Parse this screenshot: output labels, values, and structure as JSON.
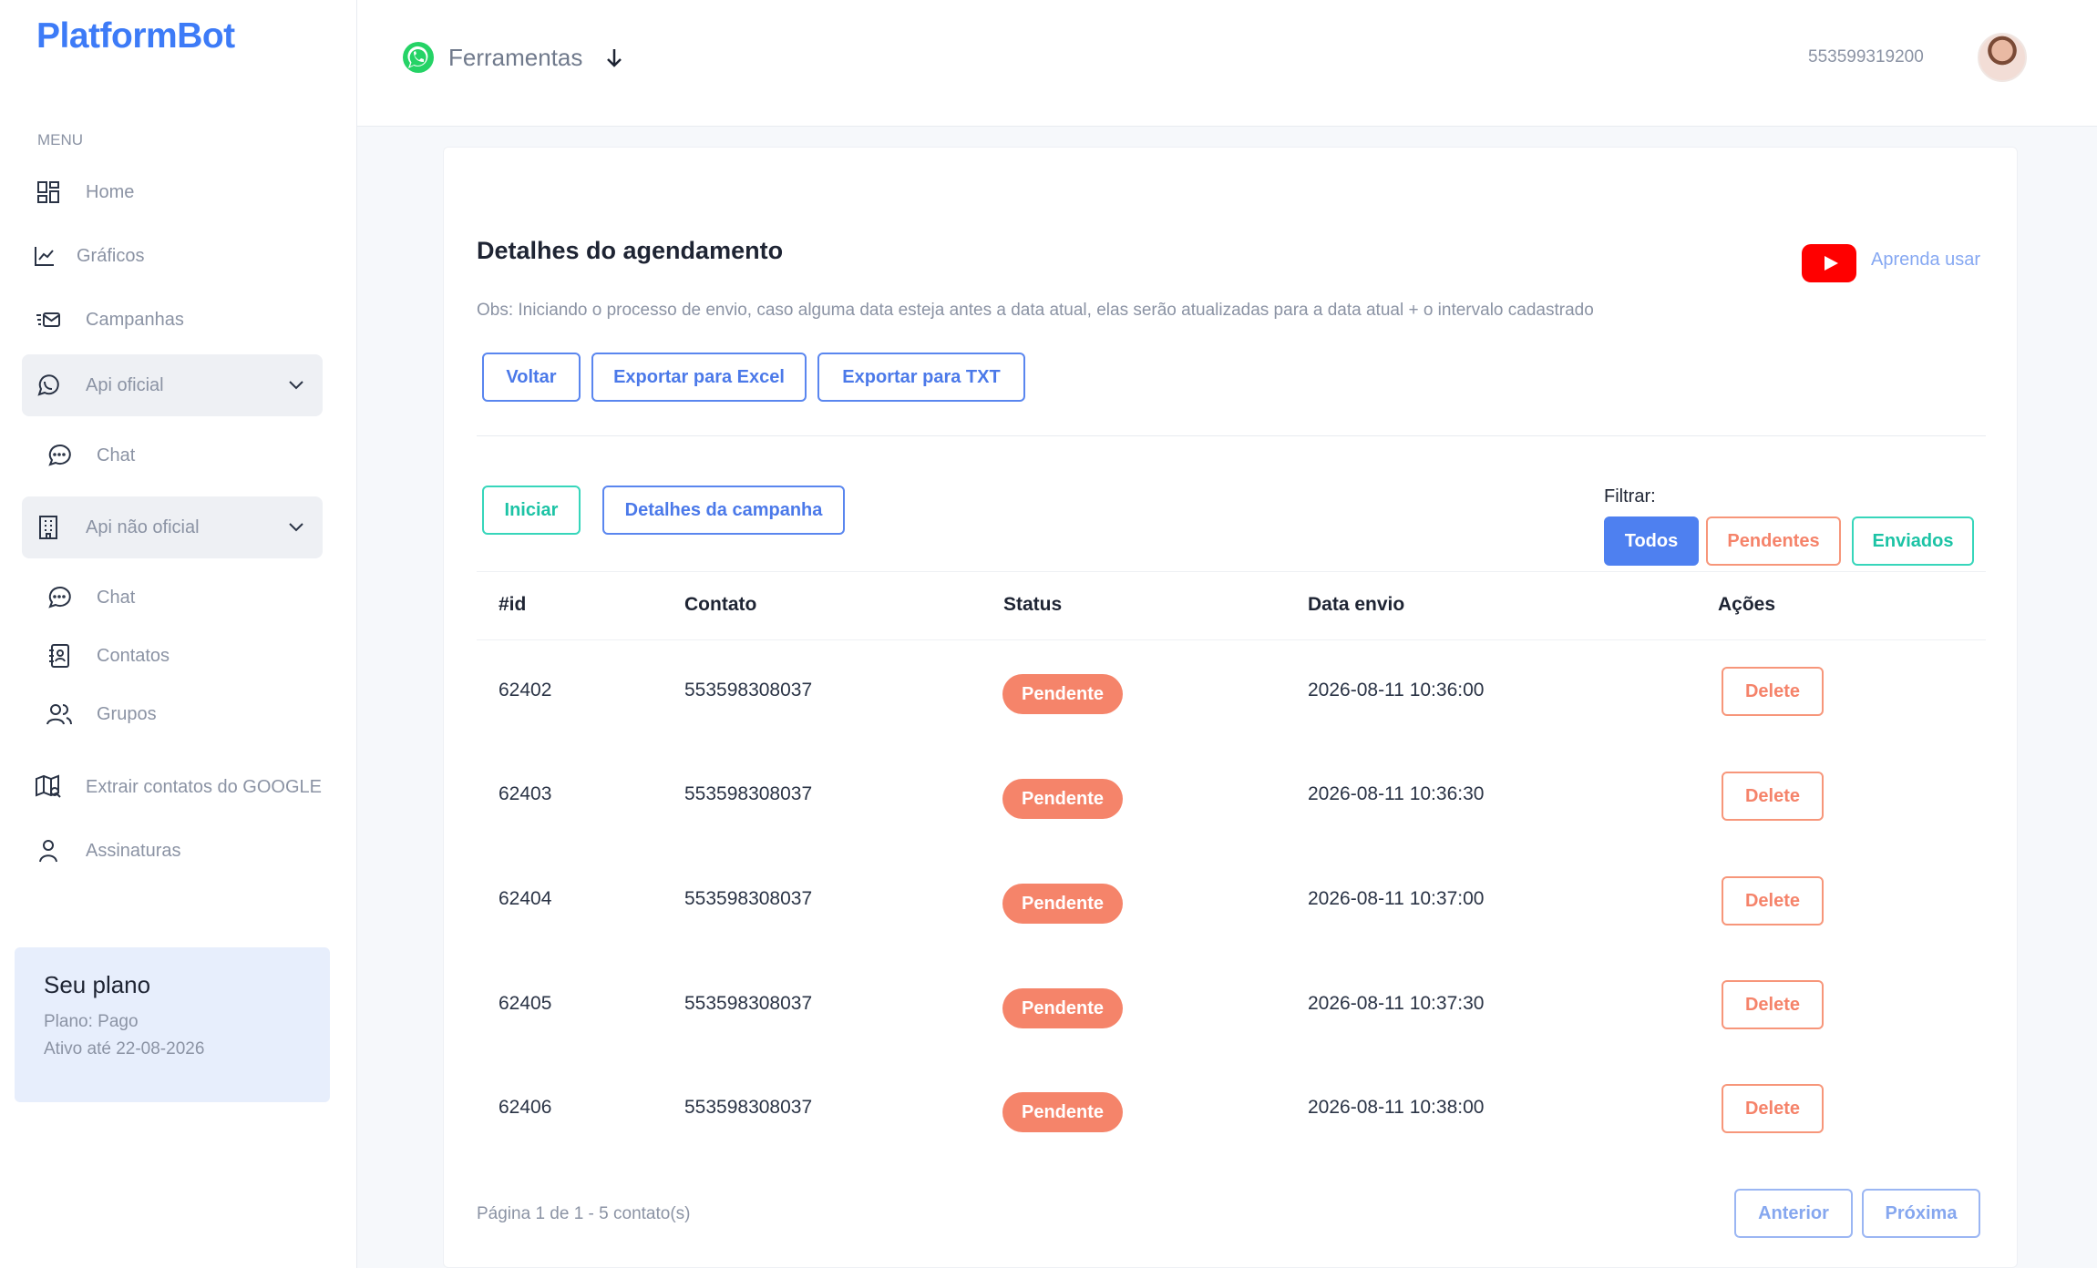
{
  "brand": {
    "logo": "PlatformBot"
  },
  "sidebar": {
    "menu_label": "MENU",
    "items": [
      {
        "label": "Home",
        "icon": "dashboard-icon"
      },
      {
        "label": "Gráficos",
        "icon": "chart-icon"
      },
      {
        "label": "Campanhas",
        "icon": "mail-icon"
      },
      {
        "label": "Api oficial",
        "icon": "whatsapp-icon",
        "expanded": true
      },
      {
        "label": "Chat",
        "icon": "chat-icon"
      },
      {
        "label": "Api não oficial",
        "icon": "building-icon",
        "expanded": true
      },
      {
        "label": "Chat",
        "icon": "chat-icon"
      },
      {
        "label": "Contatos",
        "icon": "contacts-icon"
      },
      {
        "label": "Grupos",
        "icon": "users-icon"
      },
      {
        "label": "Extrair contatos do GOOGLE",
        "icon": "map-icon"
      },
      {
        "label": "Assinaturas",
        "icon": "user-icon"
      }
    ],
    "plan": {
      "title": "Seu plano",
      "line1": "Plano: Pago",
      "line2": "Ativo até 22-08-2026"
    }
  },
  "header": {
    "tools_label": "Ferramentas",
    "phone": "553599319200"
  },
  "main": {
    "title": "Detalhes do agendamento",
    "learn_link": "Aprenda usar",
    "obs": "Obs: Iniciando o processo de envio, caso alguma data esteja antes a data atual, elas serão atualizadas para a data atual + o intervalo cadastrado",
    "buttons": {
      "back": "Voltar",
      "export_excel": "Exportar para Excel",
      "export_txt": "Exportar para TXT",
      "start": "Iniciar",
      "campaign_details": "Detalhes da campanha"
    },
    "filter": {
      "label": "Filtrar:",
      "all": "Todos",
      "pending": "Pendentes",
      "sent": "Enviados"
    },
    "table": {
      "headers": [
        "#id",
        "Contato",
        "Status",
        "Data envio",
        "Ações"
      ],
      "rows": [
        {
          "id": "62402",
          "contact": "553598308037",
          "status": "Pendente",
          "date": "2026-08-11 10:36:00",
          "action": "Delete"
        },
        {
          "id": "62403",
          "contact": "553598308037",
          "status": "Pendente",
          "date": "2026-08-11 10:36:30",
          "action": "Delete"
        },
        {
          "id": "62404",
          "contact": "553598308037",
          "status": "Pendente",
          "date": "2026-08-11 10:37:00",
          "action": "Delete"
        },
        {
          "id": "62405",
          "contact": "553598308037",
          "status": "Pendente",
          "date": "2026-08-11 10:37:30",
          "action": "Delete"
        },
        {
          "id": "62406",
          "contact": "553598308037",
          "status": "Pendente",
          "date": "2026-08-11 10:38:00",
          "action": "Delete"
        }
      ]
    },
    "pager": {
      "text": "Página 1 de 1 - 5 contato(s)",
      "prev": "Anterior",
      "next": "Próxima"
    }
  },
  "colors": {
    "primary": "#4e80f0",
    "teal": "#1cc3a5",
    "orange": "#f5846a",
    "plan_bg": "#e7eefc",
    "youtube": "#ff0000"
  }
}
